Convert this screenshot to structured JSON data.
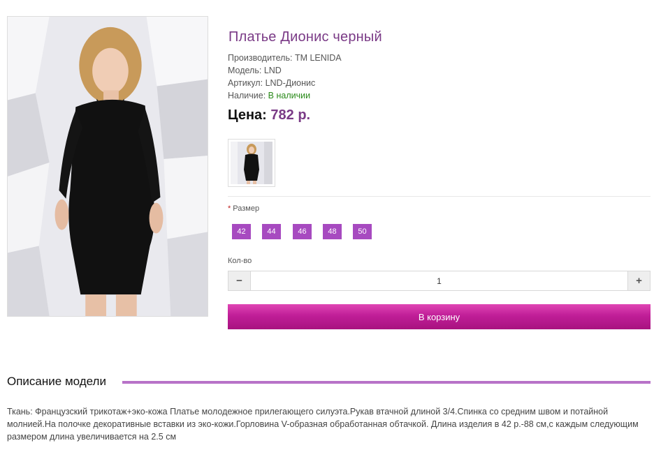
{
  "product": {
    "title": "Платье Дионис черный",
    "manufacturer": {
      "label": "Производитель:",
      "value": "TM LENIDA"
    },
    "model": {
      "label": "Модель:",
      "value": "LND"
    },
    "sku": {
      "label": "Артикул:",
      "value": "LND-Дионис"
    },
    "availability": {
      "label": "Наличие:",
      "value": "В наличии"
    },
    "price": {
      "label": "Цена:",
      "value": "782 р."
    }
  },
  "options": {
    "size_label": "Размер",
    "required_mark": "*",
    "sizes": [
      "42",
      "44",
      "46",
      "48",
      "50"
    ],
    "qty_label": "Кол-во",
    "qty_value": "1",
    "minus": "−",
    "plus": "+"
  },
  "cart_button": "В корзину",
  "description": {
    "heading": "Описание модели",
    "text": "Ткань: Французский трикотаж+эко-кожа Платье молодежное прилегающего силуэта.Рукав втачной длиной 3/4.Спинка со средним швом и потайной молнией.На полочке декоративные вставки из эко-кожи.Горловина V-образная обработанная обтачкой. Длина изделия в 42 р.-88 см,с каждым следующим размером длина увеличивается на 2.5 см"
  },
  "colors": {
    "accent": "#7a3a86",
    "size_button": "#a74ac0",
    "cart": "#c01e98",
    "in_stock": "#2a8a1a"
  }
}
